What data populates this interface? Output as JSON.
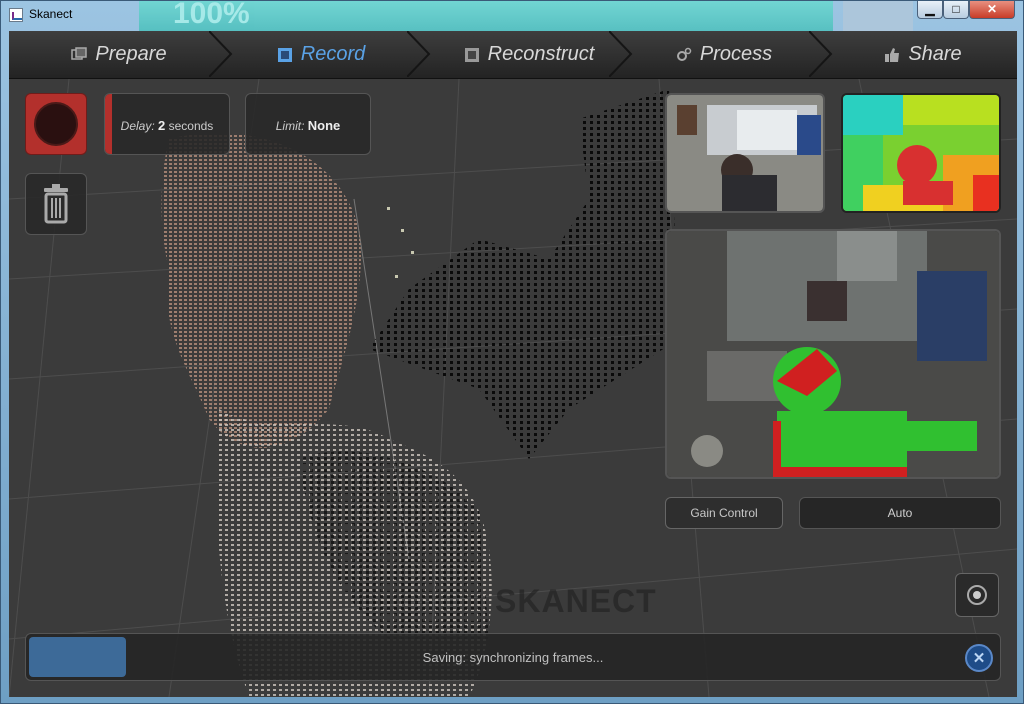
{
  "window": {
    "title": "Skanect",
    "background_banner_text": "100%",
    "controls": {
      "minimize": "▁",
      "maximize": "□",
      "close": "✕"
    }
  },
  "nav": {
    "tabs": [
      {
        "label": "Prepare",
        "icon": "photos-icon",
        "active": false
      },
      {
        "label": "Record",
        "icon": "film-icon",
        "active": true
      },
      {
        "label": "Reconstruct",
        "icon": "film-strip-icon",
        "active": false
      },
      {
        "label": "Process",
        "icon": "gears-icon",
        "active": false
      },
      {
        "label": "Share",
        "icon": "thumbs-up-icon",
        "active": false
      }
    ]
  },
  "record": {
    "delay_label": "Delay:",
    "delay_value": "2",
    "delay_unit": "seconds",
    "limit_label": "Limit:",
    "limit_value": "None"
  },
  "camera": {
    "gain_control_label": "Gain Control",
    "gain_mode": "Auto"
  },
  "watermark": "SKANECT",
  "status": {
    "text": "Saving: synchronizing frames...",
    "progress_fraction": 0.1
  },
  "colors": {
    "accent": "#5aa2e6",
    "record_red": "#b3302c",
    "progress_blue": "#3d6a98"
  }
}
